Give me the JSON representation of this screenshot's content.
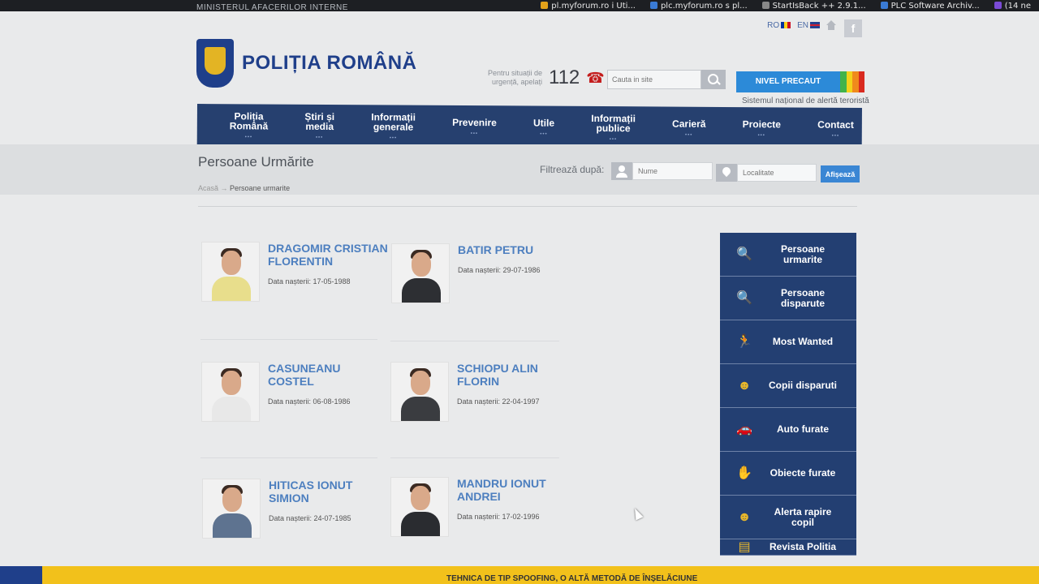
{
  "browser": {
    "bookmarks": [
      {
        "label": "pl.myforum.ro i Uti...",
        "color": "#e3a21a"
      },
      {
        "label": "plc.myforum.ro s pl...",
        "color": "#3a7bd5"
      },
      {
        "label": "StartIsBack ++ 2.9.1...",
        "color": "#888888"
      },
      {
        "label": "PLC Software Archiv...",
        "color": "#3a7bd5"
      },
      {
        "label": "(14 ne",
        "color": "#7b4bd6"
      }
    ]
  },
  "header": {
    "ministry": "MINISTERUL AFACERILOR INTERNE",
    "lang_ro": "RO",
    "lang_en": "EN",
    "facebook": "f",
    "logo_text": "POLIȚIA ROMÂNĂ",
    "emergency_label": "Pentru situații de urgență, apelați",
    "emergency_number": "112",
    "search_placeholder": "Cauta in site",
    "alert_level": "NIVEL PRECAUT",
    "alert_colors": [
      "#2c8ad8",
      "#42b34a",
      "#f3d21a",
      "#f08a1c",
      "#d92a1f"
    ],
    "alert_sub": "Sistemul național de alertă teroristă"
  },
  "nav": [
    "Poliția\nRomână",
    "Știri și\nmedia",
    "Informații\ngenerale",
    "Prevenire",
    "Utile",
    "Informații\npublice",
    "Carieră",
    "Proiecte",
    "Contact"
  ],
  "page": {
    "title": "Persoane Urmărite",
    "filter_label": "Filtrează după:",
    "name_placeholder": "Nume",
    "locality_placeholder": "Localitate",
    "show_button": "Afișează",
    "breadcrumb_home": "Acasă",
    "breadcrumb_arrow": "→",
    "breadcrumb_current": "Persoane urmarite"
  },
  "persons": [
    {
      "name": "DRAGOMIR CRISTIAN FLORENTIN",
      "date": "Data nașterii: 17-05-1988",
      "shirt": "#e8de8c"
    },
    {
      "name": "BATIR PETRU",
      "date": "Data nașterii: 29-07-1986",
      "shirt": "#2d2f33"
    },
    {
      "name": "CASUNEANU COSTEL",
      "date": "Data nașterii: 06-08-1986",
      "shirt": "#e8e8e8"
    },
    {
      "name": "SCHIOPU ALIN FLORIN",
      "date": "Data nașterii: 22-04-1997",
      "shirt": "#3a3c40"
    },
    {
      "name": "HITICAS IONUT SIMION",
      "date": "Data nașterii: 24-07-1985",
      "shirt": "#5e7390"
    },
    {
      "name": "MANDRU IONUT ANDREI",
      "date": "Data nașterii: 17-02-1996",
      "shirt": "#2a2c30"
    }
  ],
  "sidebar": [
    {
      "label": "Persoane urmarite",
      "icon": "search-person-icon",
      "glyph": "🔍"
    },
    {
      "label": "Persoane disparute",
      "icon": "search-person-icon",
      "glyph": "🔍"
    },
    {
      "label": "Most Wanted",
      "icon": "running-man-icon",
      "glyph": "🏃"
    },
    {
      "label": "Copii disparuti",
      "icon": "child-icon",
      "glyph": "☻"
    },
    {
      "label": "Auto furate",
      "icon": "car-icon",
      "glyph": "🚗"
    },
    {
      "label": "Obiecte furate",
      "icon": "hand-icon",
      "glyph": "✋"
    },
    {
      "label": "Alerta rapire copil",
      "icon": "alert-child-icon",
      "glyph": "☻"
    },
    {
      "label": "Revista Politia",
      "icon": "magazine-icon",
      "glyph": "▤"
    }
  ],
  "ticker": "TEHNICA DE TIP SPOOFING, O ALTĂ METODĂ DE ÎNȘELĂCIUNE"
}
